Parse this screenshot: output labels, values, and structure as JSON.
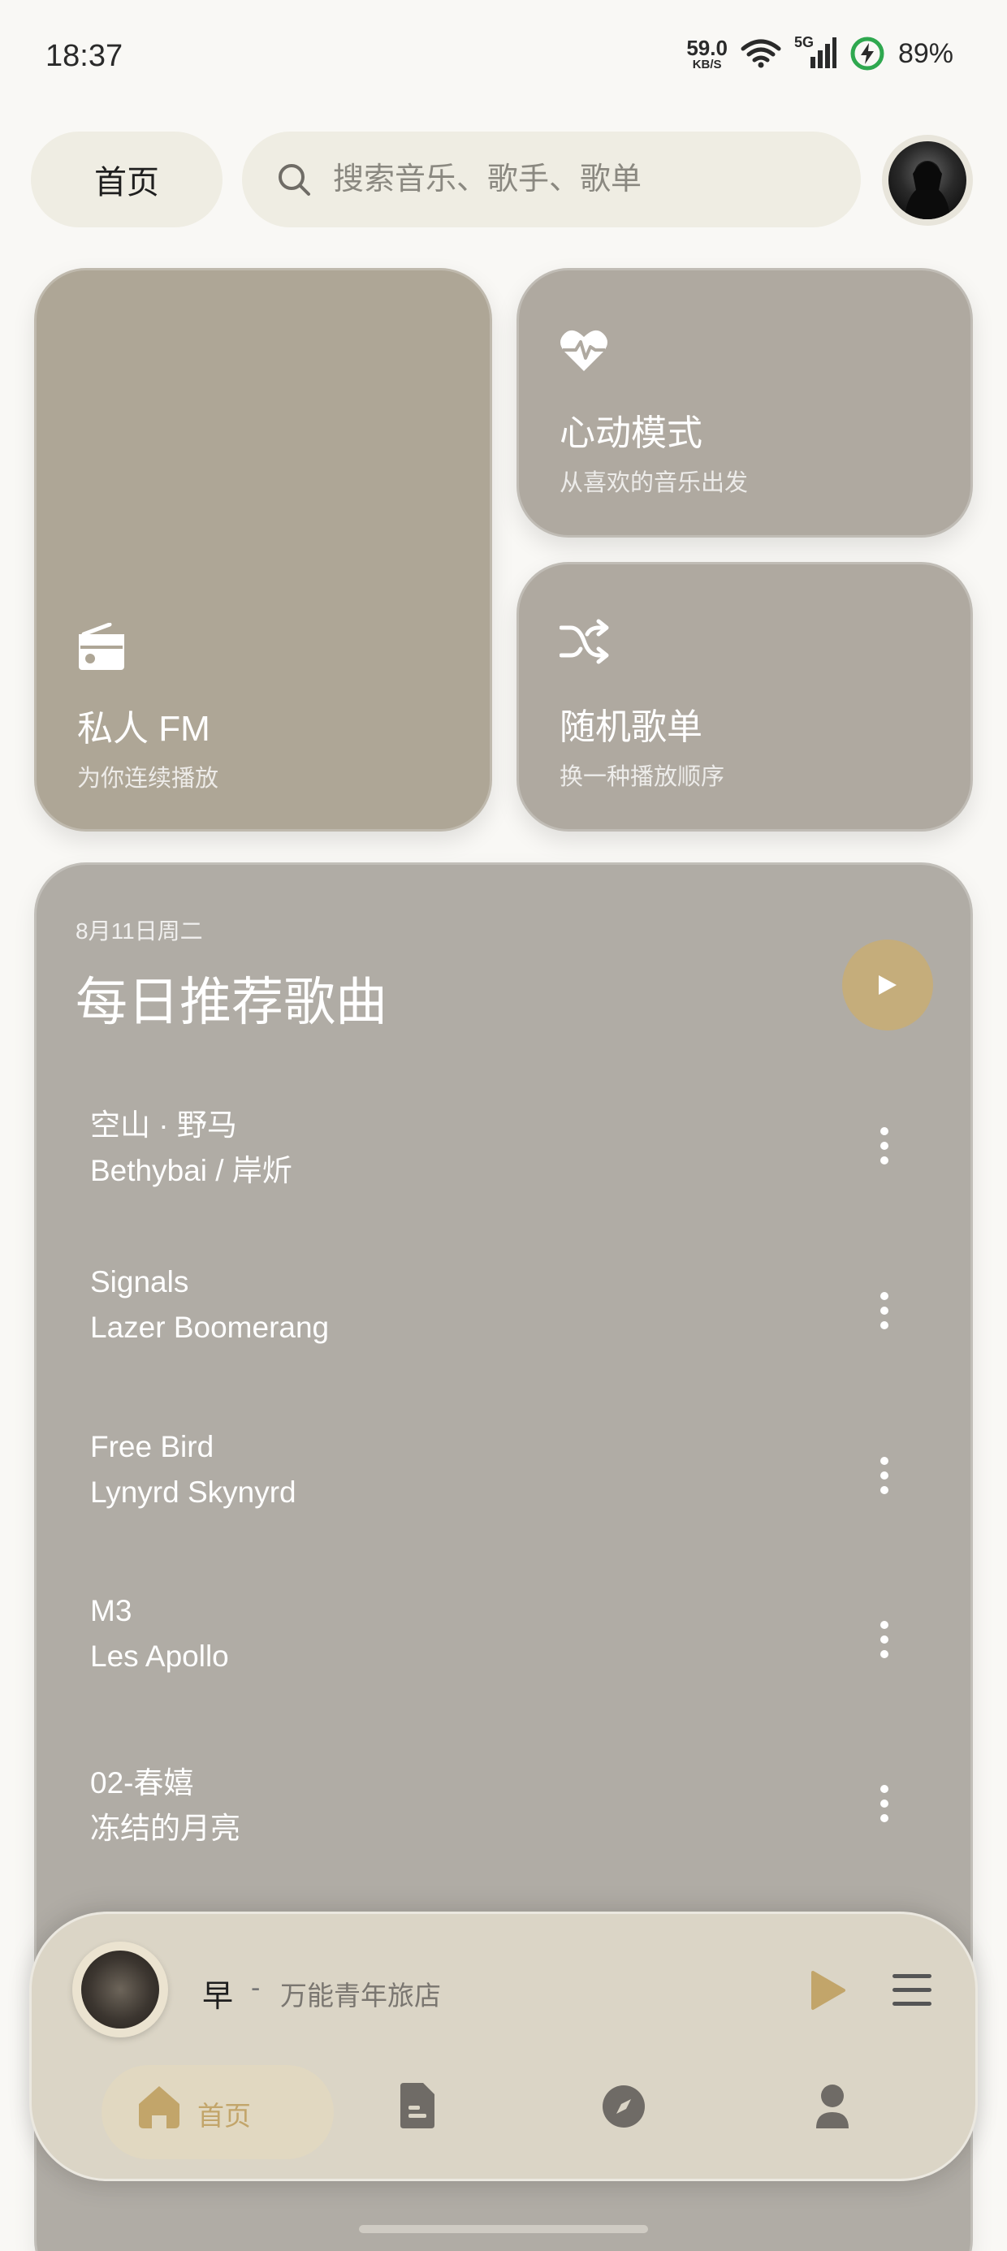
{
  "status_bar": {
    "time": "18:37",
    "net_speed_value": "59.0",
    "net_speed_unit": "KB/S",
    "network_type": "5G",
    "battery": "89%",
    "icons": [
      "wifi-icon",
      "signal-icon",
      "battery-charging-icon"
    ]
  },
  "header": {
    "home_label": "首页",
    "search_placeholder": "搜索音乐、歌手、歌单",
    "search_icon": "search-icon",
    "avatar_icon": "avatar"
  },
  "cards": {
    "fm": {
      "icon": "radio-icon",
      "title": "私人 FM",
      "subtitle": "为你连续播放"
    },
    "heart": {
      "icon": "heart-pulse-icon",
      "title": "心动模式",
      "subtitle": "从喜欢的音乐出发"
    },
    "random": {
      "icon": "shuffle-icon",
      "title": "随机歌单",
      "subtitle": "换一种播放顺序"
    }
  },
  "daily": {
    "date": "8月11日周二",
    "title": "每日推荐歌曲",
    "songs": [
      {
        "title": "空山 · 野马",
        "artist": "Bethybai / 岸炘"
      },
      {
        "title": "Signals",
        "artist": "Lazer Boomerang"
      },
      {
        "title": "Free Bird",
        "artist": "Lynyrd Skynyrd"
      },
      {
        "title": "M3",
        "artist": "Les Apollo"
      },
      {
        "title": "02-春嬉",
        "artist": "冻结的月亮"
      }
    ]
  },
  "player": {
    "song": "早",
    "separator": "-",
    "artist": "万能青年旅店"
  },
  "bottom_nav": {
    "items": [
      {
        "label": "首页",
        "icon": "home-icon",
        "active": true
      },
      {
        "label": "",
        "icon": "document-icon",
        "active": false
      },
      {
        "label": "",
        "icon": "compass-icon",
        "active": false
      },
      {
        "label": "",
        "icon": "user-icon",
        "active": false
      }
    ]
  },
  "colors": {
    "accent": "#c2a56a",
    "card": "#afa9a0",
    "search_bg": "#efede3",
    "player_bg": "#dbd5c6"
  }
}
